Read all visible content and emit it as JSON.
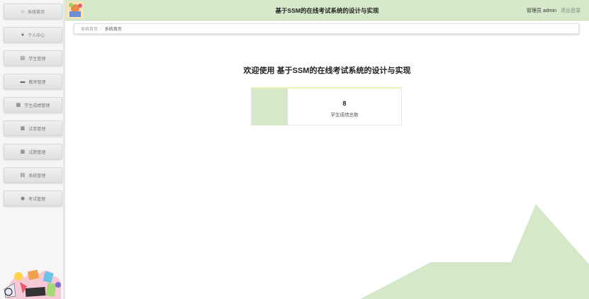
{
  "header": {
    "title": "基于SSM的在线考试系统的设计与实现",
    "user_label": "管理员 admin",
    "logout_label": "退出登录"
  },
  "sidebar": {
    "items": [
      {
        "label": "系统首页",
        "icon": "home-icon"
      },
      {
        "label": "个人中心",
        "icon": "user-icon"
      },
      {
        "label": "学生管理",
        "icon": "clipboard-icon"
      },
      {
        "label": "教师管理",
        "icon": "card-icon"
      },
      {
        "label": "学生成绩管理",
        "icon": "grid-icon"
      },
      {
        "label": "试卷管理",
        "icon": "grid-icon"
      },
      {
        "label": "试题管理",
        "icon": "grid-icon"
      },
      {
        "label": "系统管理",
        "icon": "clipboard-icon"
      },
      {
        "label": "考试管理",
        "icon": "pin-icon"
      }
    ]
  },
  "breadcrumb": {
    "home": "系统首页",
    "current": "系统首页"
  },
  "main": {
    "welcome": "欢迎使用 基于SSM的在线考试系统的设计与实现",
    "stat": {
      "value": "8",
      "label": "学生成绩总数"
    }
  },
  "colors": {
    "accent": "#d5e8c8",
    "card_top": "#ecf3b5"
  }
}
